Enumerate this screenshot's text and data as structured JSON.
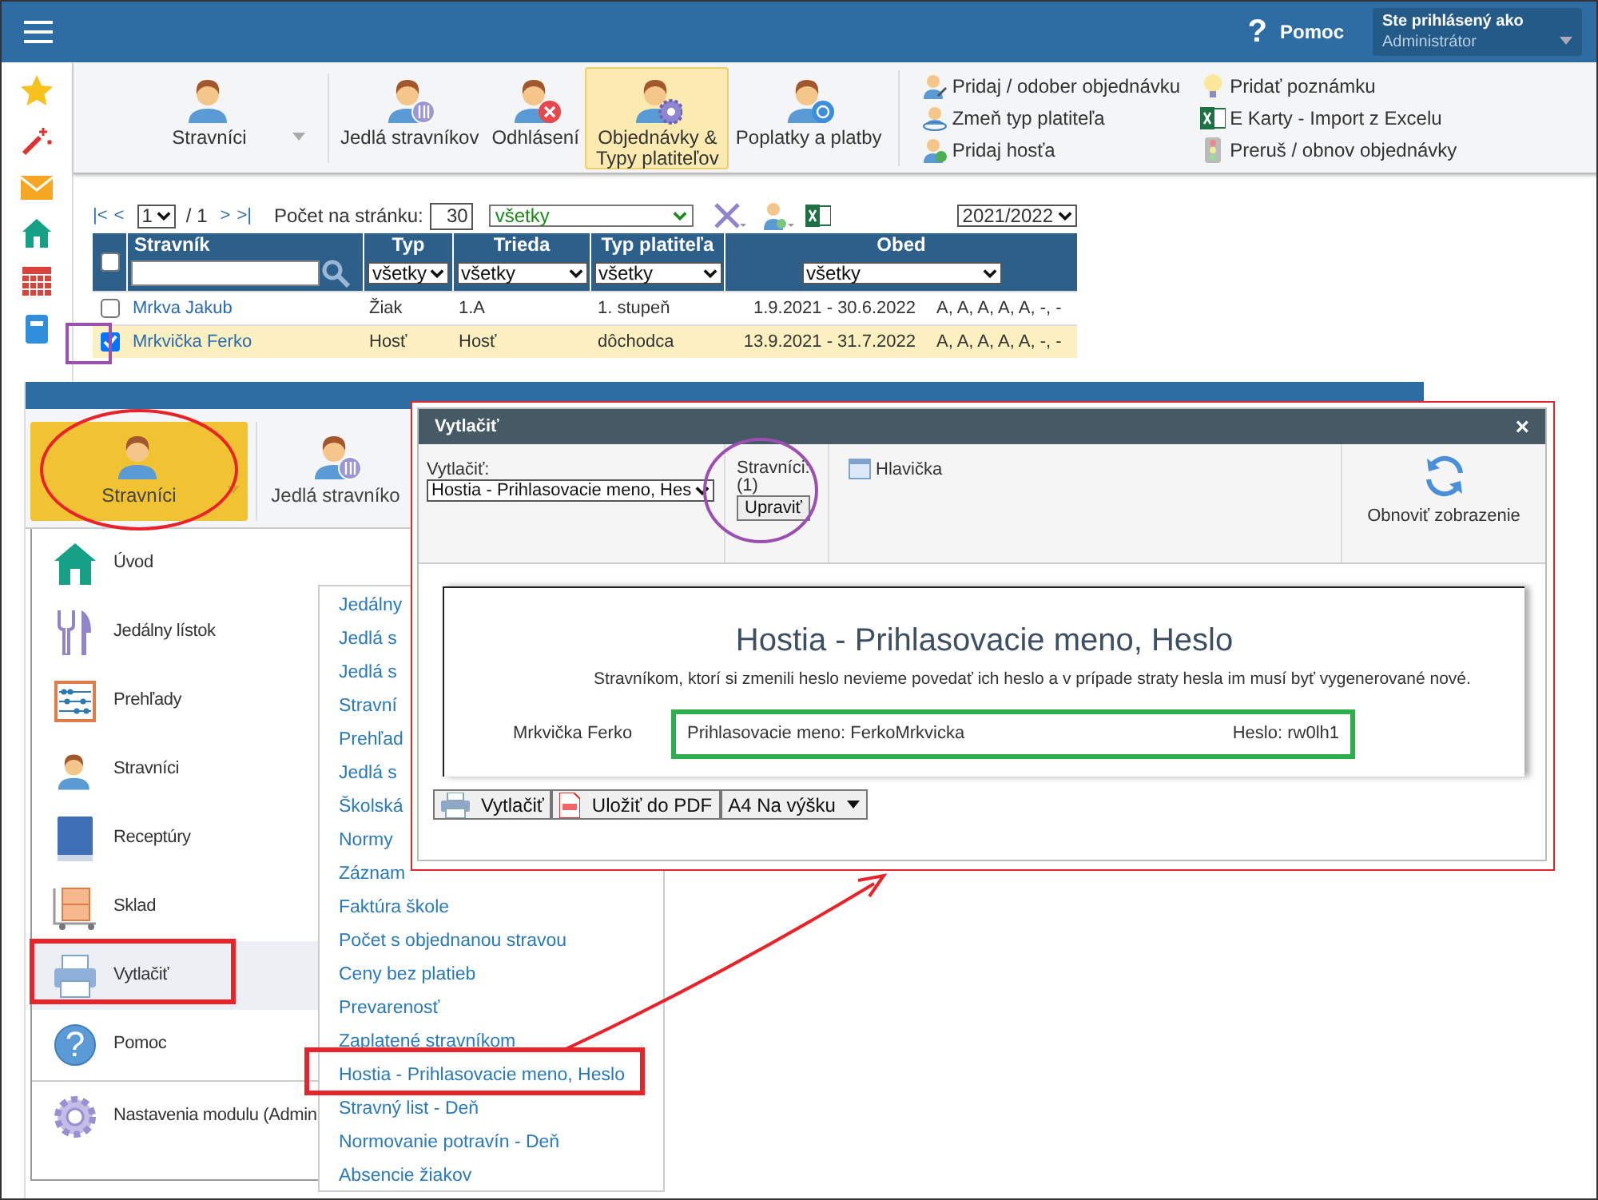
{
  "top_bar": {
    "help_icon": "?",
    "help": "Pomoc",
    "user_label": "Ste prihlásený ako",
    "user_name": "Administrátor"
  },
  "ribbon": {
    "buttons": [
      {
        "label": "Stravníci",
        "selected": false,
        "kind": "menu"
      },
      {
        "label": "Jedlá stravníkov",
        "selected": false,
        "kind": "meals"
      },
      {
        "label": "Odhlásení",
        "selected": false,
        "kind": "cancel"
      },
      {
        "label": "Objednávky & Typy platiteľov",
        "selected": true,
        "kind": "orders"
      },
      {
        "label": "Poplatky a platby",
        "selected": false,
        "kind": "payments"
      }
    ],
    "actions": [
      {
        "label": "Pridaj / odober objednávku",
        "kind": "order"
      },
      {
        "label": "Zmeň typ platiteľa",
        "kind": "payer"
      },
      {
        "label": "Pridaj hosťa",
        "kind": "guest"
      },
      {
        "label": "Pridať poznámku",
        "kind": "note"
      },
      {
        "label": "E Karty - Import z Excelu",
        "kind": "excel"
      },
      {
        "label": "Preruš / obnov objednávky",
        "kind": "pause"
      }
    ]
  },
  "pager": {
    "first": "|<",
    "prev": "<",
    "page": "1",
    "total": "/ 1",
    "next": ">",
    "last": ">|",
    "per_page_label": "Počet na stránku:",
    "per_page": "30",
    "filter": "všetky",
    "year": "2021/2022"
  },
  "table": {
    "all_checked": false,
    "columns": [
      "Stravník",
      "Typ",
      "Trieda",
      "Typ platiteľa",
      "Obed"
    ],
    "filters": [
      "všetky",
      "všetky",
      "všetky",
      "všetky"
    ],
    "rows": [
      {
        "checked": false,
        "cells": [
          "Mrkva Jakub",
          "Žiak",
          "1.A",
          "1. stupeň",
          "1.9.2021 - 30.6.2022",
          "A, A, A, A, A, -, -"
        ]
      },
      {
        "checked": true,
        "cells": [
          "Mrkvička Ferko",
          "Hosť",
          "Hosť",
          "dôchodca",
          "13.9.2021 - 31.7.2022",
          "A, A, A, A, A, -, -"
        ]
      }
    ]
  },
  "overlay": {
    "ribbon": [
      {
        "label": "Stravníci",
        "selected": true,
        "kind": "menu"
      },
      {
        "label": "Jedlá stravníko",
        "selected": false,
        "kind": "meals"
      }
    ],
    "menu": [
      {
        "label": "Úvod",
        "kind": "home",
        "selected": false
      },
      {
        "label": "Jedálny lístok",
        "kind": "cutlery",
        "selected": false
      },
      {
        "label": "Prehľady",
        "kind": "abacus",
        "selected": false
      },
      {
        "label": "Stravníci",
        "kind": "person",
        "selected": false
      },
      {
        "label": "Receptúry",
        "kind": "book",
        "selected": false
      },
      {
        "label": "Sklad",
        "kind": "storage",
        "selected": false
      },
      {
        "label": "Vytlačiť",
        "kind": "printer",
        "selected": true
      },
      {
        "label": "Pomoc",
        "kind": "help",
        "icon": "?",
        "selected": false
      },
      {
        "label": "Nastavenia modulu (Admin",
        "kind": "gear",
        "selected": false
      }
    ],
    "submenu": [
      "Jedálny",
      "Jedlá s",
      "Jedlá s",
      "Stravní",
      "Prehľad",
      "Jedlá s",
      "Školská",
      "Normy",
      "Záznam",
      "Faktúra škole",
      "Počet s objednanou stravou",
      "Ceny bez platieb",
      "Prevarenosť",
      "Zaplatené stravníkom",
      "Hostia - Prihlasovacie meno, Heslo",
      "Stravný list - Deň",
      "Normovanie potravín - Deň",
      "Absencie žiakov"
    ]
  },
  "dialog": {
    "title": "Vytlačiť",
    "close": "×",
    "print_label": "Vytlačiť:",
    "print_value": "Hostia - Prihlasovacie meno, Hes",
    "diners_label": "Stravníci:",
    "diners_count": "(1)",
    "edit": "Upraviť",
    "header_option": "Hlavička",
    "refresh": "Obnoviť zobrazenie",
    "preview": {
      "title": "Hostia - Prihlasovacie meno, Heslo",
      "note": "Stravníkom, ktorí si zmenili heslo nevieme povedať ich heslo a v prípade straty hesla im musí byť vygenerované nové.",
      "rows": [
        {
          "name": "Mrkvička Ferko",
          "login": "Prihlasovacie meno: FerkoMrkvicka",
          "password": "Heslo: rw0lh1"
        }
      ]
    },
    "buttons": [
      {
        "label": "Vytlačiť",
        "kind": "print"
      },
      {
        "label": "Uložiť do PDF",
        "kind": "pdf"
      },
      {
        "label": "A4 Na výšku",
        "kind": "dropdown"
      }
    ]
  }
}
